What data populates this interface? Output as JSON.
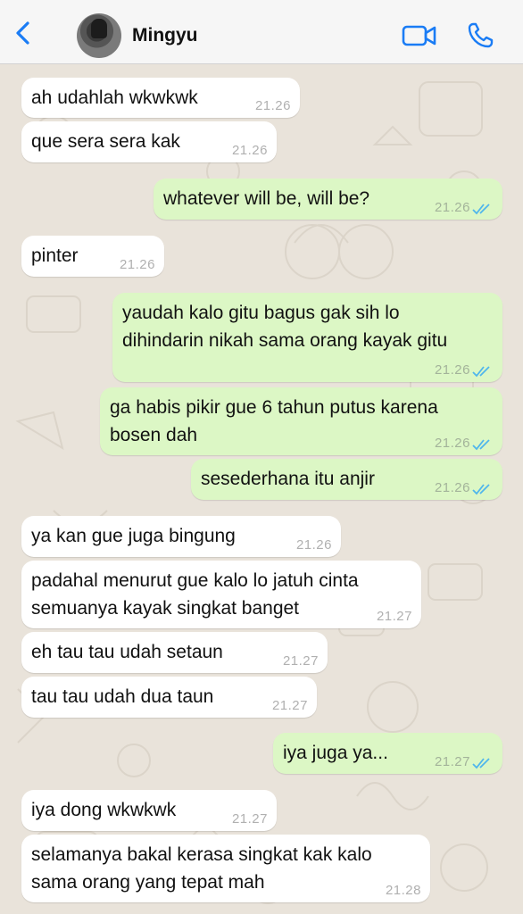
{
  "header": {
    "contact_name": "Mingyu",
    "back_icon": "chevron-left-icon",
    "video_icon": "video-camera-icon",
    "call_icon": "phone-icon",
    "accent_color": "#1a7cf5"
  },
  "messages": [
    {
      "direction": "in",
      "text": "ah udahlah wkwkwk",
      "time": "21.26"
    },
    {
      "direction": "in",
      "text": "que sera sera kak",
      "time": "21.26"
    },
    {
      "direction": "out",
      "text": "whatever will be, will be?",
      "time": "21.26",
      "status": "read"
    },
    {
      "direction": "in",
      "text": "pinter",
      "time": "21.26"
    },
    {
      "direction": "out",
      "text": "yaudah kalo gitu bagus gak sih lo\ndihindarin nikah sama orang kayak gitu",
      "time": "21.26",
      "status": "read"
    },
    {
      "direction": "out",
      "text": "ga habis pikir gue 6 tahun putus karena\nbosen dah",
      "time": "21.26",
      "status": "read"
    },
    {
      "direction": "out",
      "text": "sesederhana itu anjir",
      "time": "21.26",
      "status": "read"
    },
    {
      "direction": "in",
      "text": "ya kan gue juga bingung",
      "time": "21.26"
    },
    {
      "direction": "in",
      "text": "padahal menurut gue kalo lo jatuh cinta\nsemuanya kayak singkat banget",
      "time": "21.27"
    },
    {
      "direction": "in",
      "text": "eh tau tau udah setaun",
      "time": "21.27"
    },
    {
      "direction": "in",
      "text": "tau tau udah dua taun",
      "time": "21.27"
    },
    {
      "direction": "out",
      "text": "iya juga ya...",
      "time": "21.27",
      "status": "read"
    },
    {
      "direction": "in",
      "text": "iya dong wkwkwk",
      "time": "21.27"
    },
    {
      "direction": "in",
      "text": "selamanya bakal kerasa singkat kak kalo\nsama orang yang tepat mah",
      "time": "21.28"
    }
  ],
  "colors": {
    "incoming_bubble": "#ffffff",
    "outgoing_bubble": "#dcf7c5",
    "read_ticks": "#4fb6ec",
    "chat_background": "#e9e3da"
  }
}
